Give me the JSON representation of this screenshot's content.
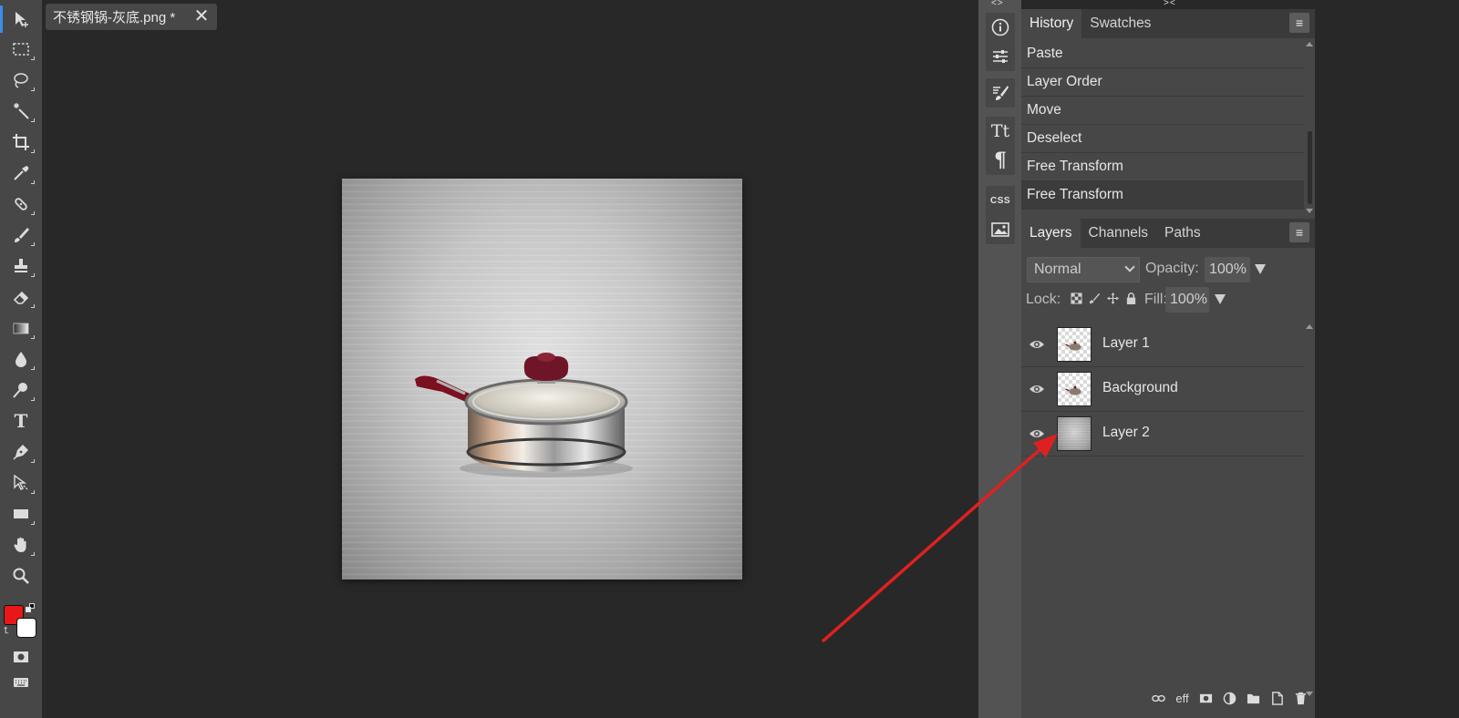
{
  "document": {
    "tab_title": "不锈钢锅-灰底.png *",
    "close_glyph": "✕"
  },
  "toolbar": {
    "tools": [
      "move-tool",
      "marquee-tool",
      "lasso-tool",
      "magic-wand-tool",
      "crop-tool",
      "eyedropper-tool",
      "healing-tool",
      "brush-tool",
      "stamp-tool",
      "eraser-tool",
      "gradient-tool",
      "blur-tool",
      "dodge-tool",
      "type-tool",
      "pen-tool",
      "path-select-tool",
      "shape-tool",
      "hand-tool",
      "zoom-tool"
    ],
    "foreground_color": "#e81818",
    "background_color": "#ffffff",
    "type_glyph": "T"
  },
  "middle_column": {
    "arrows_left": "<>",
    "arrows_right": "><",
    "css_label": "CSS",
    "text_glyph": "Tt",
    "para_glyph": "¶"
  },
  "history": {
    "tabs": [
      "History",
      "Swatches"
    ],
    "menu_glyph": "≡",
    "items": [
      "Paste",
      "Layer Order",
      "Move",
      "Deselect",
      "Free Transform",
      "Free Transform"
    ]
  },
  "layers": {
    "tabs": [
      "Layers",
      "Channels",
      "Paths"
    ],
    "menu_glyph": "≡",
    "blend_mode": "Normal",
    "opacity_label": "Opacity:",
    "opacity_value": "100%",
    "lock_label": "Lock:",
    "fill_label": "Fill:",
    "fill_value": "100%",
    "rows": [
      {
        "name": "Layer 1",
        "thumb": "checker"
      },
      {
        "name": "Background",
        "thumb": "checker"
      },
      {
        "name": "Layer 2",
        "thumb": "metal"
      }
    ],
    "bottom_eff_label": "eff"
  },
  "annotation": {
    "arrow_color": "#e02020"
  }
}
